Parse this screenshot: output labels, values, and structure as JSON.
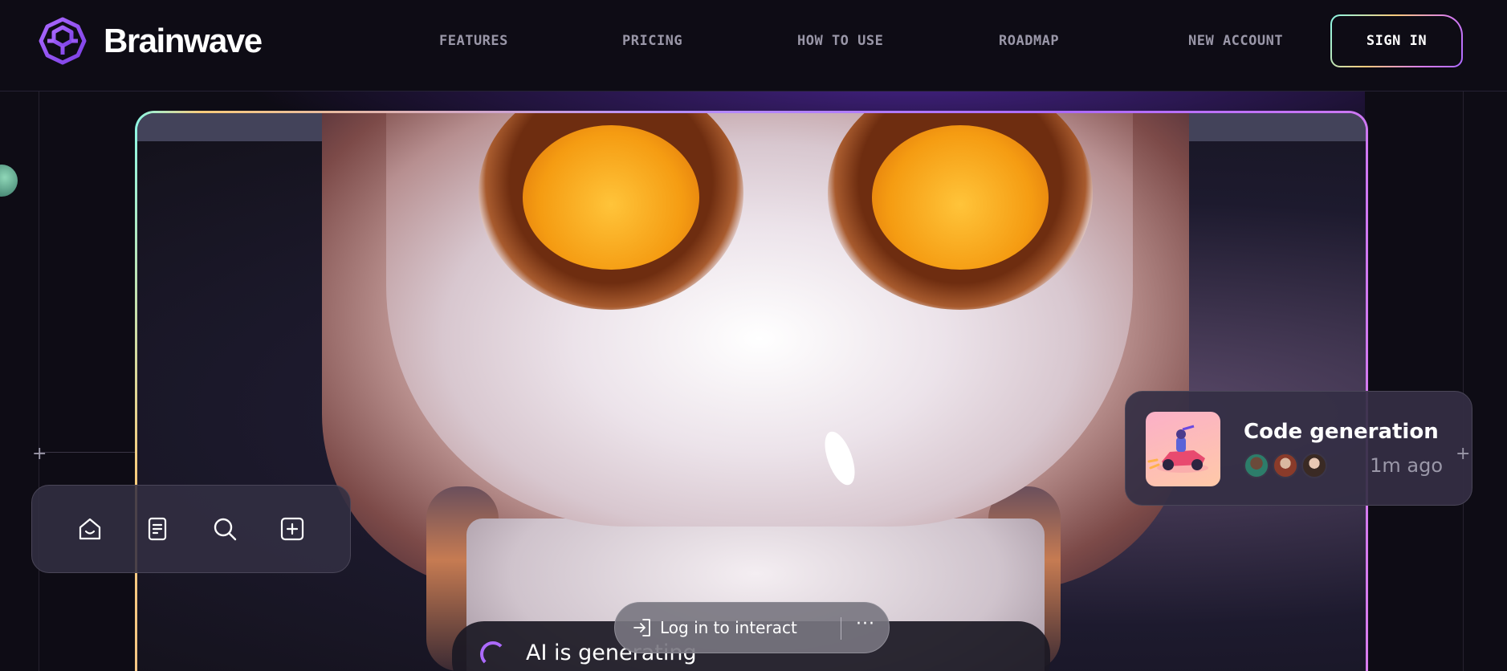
{
  "brand": {
    "name": "Brainwave",
    "logo_icon": "brain-maze-icon",
    "accent": "#ac6aff"
  },
  "nav": {
    "items": [
      {
        "label": "FEATURES"
      },
      {
        "label": "PRICING"
      },
      {
        "label": "HOW TO USE"
      },
      {
        "label": "ROADMAP"
      },
      {
        "label": "NEW ACCOUNT"
      }
    ],
    "signin_label": "SIGN IN"
  },
  "toolbar": {
    "icons": [
      "home-icon",
      "document-icon",
      "search-icon",
      "add-square-icon"
    ]
  },
  "notification": {
    "title": "Code generation",
    "time": "1m ago",
    "thumbnail_icon": "race-car-illustration-icon",
    "avatars": [
      "avatar-1",
      "avatar-2",
      "avatar-3"
    ]
  },
  "status": {
    "generating_text": "AI is generating"
  },
  "login_prompt": {
    "label": "Log in to interact",
    "more": "···"
  }
}
